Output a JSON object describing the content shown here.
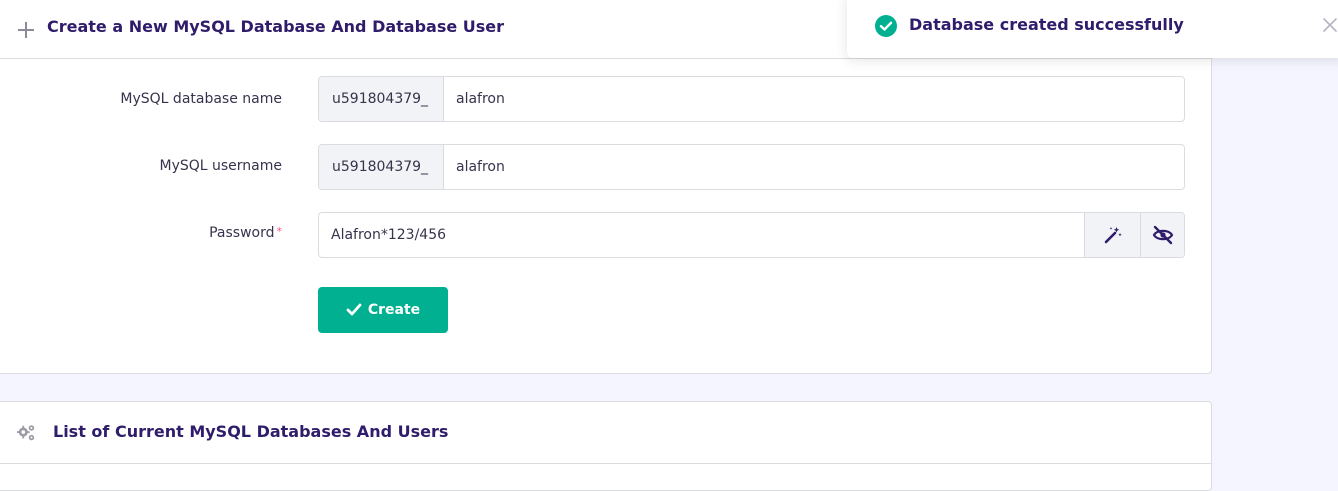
{
  "create_card": {
    "title": "Create a New MySQL Database And Database User",
    "database_name": {
      "label": "MySQL database name",
      "prefix": "u591804379_",
      "value": "alafron"
    },
    "username": {
      "label": "MySQL username",
      "prefix": "u591804379_",
      "value": "alafron"
    },
    "password": {
      "label": "Password",
      "required_mark": "*",
      "value": "Alafron*123/456"
    },
    "create_button": {
      "label": "Create"
    }
  },
  "list_card": {
    "title": "List of Current MySQL Databases And Users"
  },
  "toast": {
    "message": "Database created successfully",
    "status": "success"
  },
  "colors": {
    "accent": "#00b090",
    "title": "#2f1c6a",
    "text": "#36344d",
    "background": "#f4f5ff"
  },
  "icons": {
    "create_header": "plus-icon",
    "list_header": "gears-icon",
    "generate_password": "magic-wand-icon",
    "toggle_visibility": "eye-slash-icon",
    "create_button": "check-icon",
    "toast_status": "check-circle-icon",
    "toast_close": "close-icon"
  }
}
